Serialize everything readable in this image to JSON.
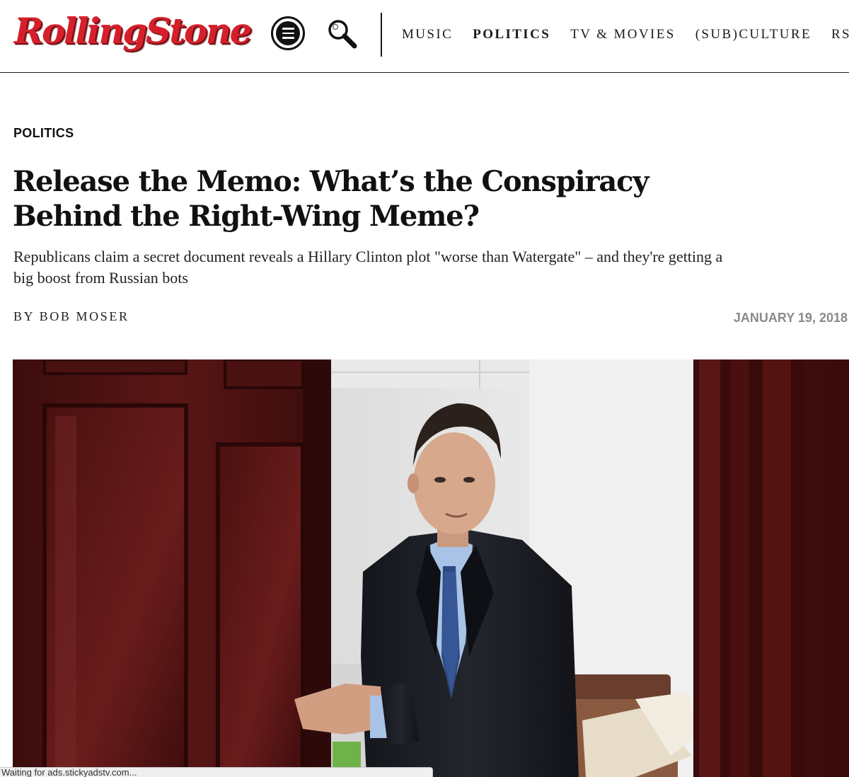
{
  "site": {
    "logo_text": "RollingStone",
    "brand_color": "#d5202b"
  },
  "header": {
    "menu_icon": "hamburger-menu-icon",
    "search_icon": "magnifier-icon",
    "nav": [
      {
        "label": "MUSIC",
        "active": false
      },
      {
        "label": "POLITICS",
        "active": true
      },
      {
        "label": "TV & MOVIES",
        "active": false
      },
      {
        "label": "(SUB)CULTURE",
        "active": false
      },
      {
        "label": "RS",
        "active": false
      }
    ]
  },
  "article": {
    "category": "POLITICS",
    "headline": "Release the Memo: What’s the Conspiracy Behind the Right-Wing Meme?",
    "dek": "Republicans claim a secret document reveals a Hillary Clinton plot \"worse than Watergate\" – and they're getting a big boost from Russian bots",
    "byline": "BY BOB MOSER",
    "date": "JANUARY 19, 2018"
  },
  "status_bar": {
    "text": "Waiting for ads.stickyadstv.com..."
  }
}
